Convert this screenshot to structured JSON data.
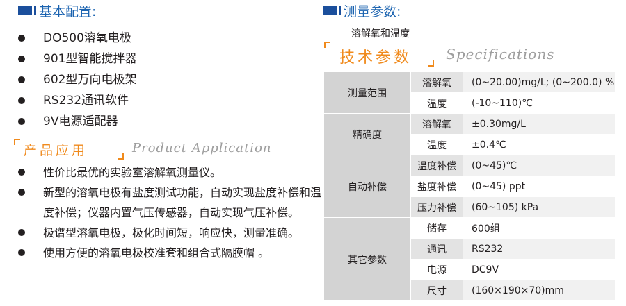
{
  "left": {
    "basic_title": "基本配置:",
    "basic_items": [
      "DO500溶氧电极",
      "901型智能搅拌器",
      "602型万向电极架",
      "RS232通讯软件",
      "9V电源适配器"
    ],
    "app_title_cn": "产品应用",
    "app_title_en": "Product Application",
    "app_items": [
      "性价比最优的实验室溶解氧测量仪。",
      "新型的溶氧电极有盐度测试功能，自动实现盐度补偿和温度补偿；仪器内置气压传感器，自动实现气压补偿。",
      "极谱型溶氧电极，极化时间短，响应快，测量准确。",
      "使用方便的溶氧电极校准套和组合式隔膜帽 。"
    ]
  },
  "right": {
    "measure_title": "测量参数:",
    "subtitle": "溶解氧和温度",
    "spec_title_cn": "技术参数",
    "spec_title_en": "Specifications",
    "groups": [
      {
        "name": "测量范围",
        "rows": [
          {
            "param": "溶解氧",
            "value": "(0~20.00)mg/L; (0~200.0) %"
          },
          {
            "param": "温度",
            "value": "(-10~110)℃"
          }
        ]
      },
      {
        "name": "精确度",
        "rows": [
          {
            "param": "溶解氧",
            "value": "±0.30mg/L"
          },
          {
            "param": "温度",
            "value": "±0.4℃"
          }
        ]
      },
      {
        "name": "自动补偿",
        "rows": [
          {
            "param": "温度补偿",
            "value": "(0~45)℃"
          },
          {
            "param": "盐度补偿",
            "value": "(0~45) ppt"
          },
          {
            "param": "压力补偿",
            "value": "(60~105) kPa"
          }
        ]
      },
      {
        "name": "其它参数",
        "rows": [
          {
            "param": "储存",
            "value": "600组"
          },
          {
            "param": "通讯",
            "value": "RS232"
          },
          {
            "param": "电源",
            "value": "DC9V"
          },
          {
            "param": "尺寸",
            "value": "(160×190×70)mm"
          }
        ]
      }
    ]
  }
}
